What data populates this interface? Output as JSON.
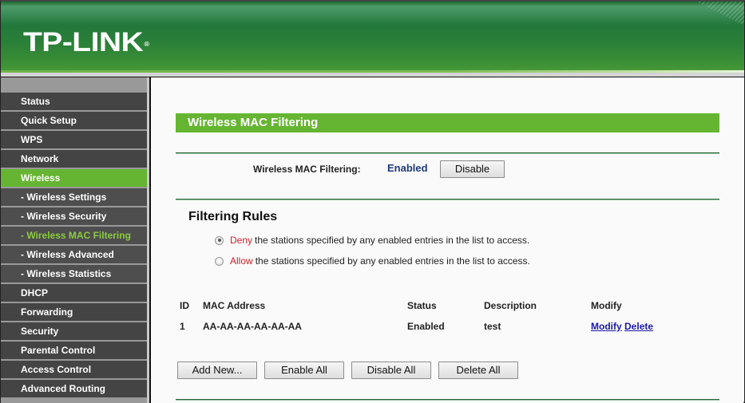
{
  "header": {
    "brand": "TP-LINK",
    "registered_mark": "®"
  },
  "sidebar": {
    "items": [
      {
        "label": "Status",
        "type": "main",
        "active": false
      },
      {
        "label": "Quick Setup",
        "type": "main",
        "active": false
      },
      {
        "label": "WPS",
        "type": "main",
        "active": false
      },
      {
        "label": "Network",
        "type": "main",
        "active": false
      },
      {
        "label": "Wireless",
        "type": "main",
        "active": true
      },
      {
        "label": "- Wireless Settings",
        "type": "sub",
        "active": false
      },
      {
        "label": "- Wireless Security",
        "type": "sub",
        "active": false
      },
      {
        "label": "- Wireless MAC Filtering",
        "type": "sub",
        "active": true
      },
      {
        "label": "- Wireless Advanced",
        "type": "sub",
        "active": false
      },
      {
        "label": "- Wireless Statistics",
        "type": "sub",
        "active": false
      },
      {
        "label": "DHCP",
        "type": "main",
        "active": false
      },
      {
        "label": "Forwarding",
        "type": "main",
        "active": false
      },
      {
        "label": "Security",
        "type": "main",
        "active": false
      },
      {
        "label": "Parental Control",
        "type": "main",
        "active": false
      },
      {
        "label": "Access Control",
        "type": "main",
        "active": false
      },
      {
        "label": "Advanced Routing",
        "type": "main",
        "active": false
      }
    ]
  },
  "main": {
    "title": "Wireless MAC Filtering",
    "mac_filtering": {
      "label": "Wireless MAC Filtering:",
      "status": "Enabled",
      "toggle_button": "Disable"
    },
    "filtering_rules": {
      "title": "Filtering Rules",
      "options": [
        {
          "keyword": "Deny",
          "text": "the stations specified by any enabled entries in the list to access.",
          "checked": true
        },
        {
          "keyword": "Allow",
          "text": "the stations specified by any enabled entries in the list to access.",
          "checked": false
        }
      ]
    },
    "table": {
      "headers": [
        "ID",
        "MAC Address",
        "Status",
        "Description",
        "Modify"
      ],
      "rows": [
        {
          "id": "1",
          "mac": "AA-AA-AA-AA-AA-AA",
          "status": "Enabled",
          "description": "test",
          "modify_link": "Modify",
          "delete_link": "Delete"
        }
      ]
    },
    "buttons": {
      "add_new": "Add New...",
      "enable_all": "Enable All",
      "disable_all": "Disable All",
      "delete_all": "Delete All"
    }
  },
  "colors": {
    "brand_green": "#66b532",
    "header_green": "#22783a",
    "nav_bg": "#444444",
    "link": "#1a1aa8",
    "keyword_red": "#d0202a",
    "status_blue": "#1f3a78"
  }
}
